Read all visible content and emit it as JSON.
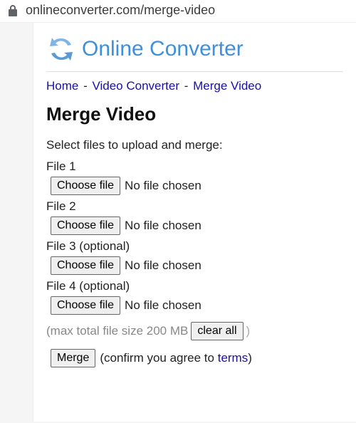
{
  "browser": {
    "url": "onlineconverter.com/merge-video"
  },
  "logo": {
    "text": "Online Converter"
  },
  "breadcrumbs": {
    "items": [
      "Home",
      "Video Converter",
      "Merge Video"
    ],
    "sep": " - "
  },
  "page": {
    "title": "Merge Video",
    "instruction": "Select files to upload and merge:"
  },
  "files": [
    {
      "label": "File 1",
      "button": "Choose file",
      "status": "No file chosen"
    },
    {
      "label": "File 2",
      "button": "Choose file",
      "status": "No file chosen"
    },
    {
      "label": "File 3 (optional)",
      "button": "Choose file",
      "status": "No file chosen"
    },
    {
      "label": "File 4 (optional)",
      "button": "Choose file",
      "status": "No file chosen"
    }
  ],
  "limit": {
    "text": "(max total file size 200 MB",
    "clear": "clear all",
    "close": ")"
  },
  "submit": {
    "button": "Merge",
    "confirm_pre": "(confirm you agree to ",
    "terms": "terms",
    "confirm_post": ")"
  }
}
